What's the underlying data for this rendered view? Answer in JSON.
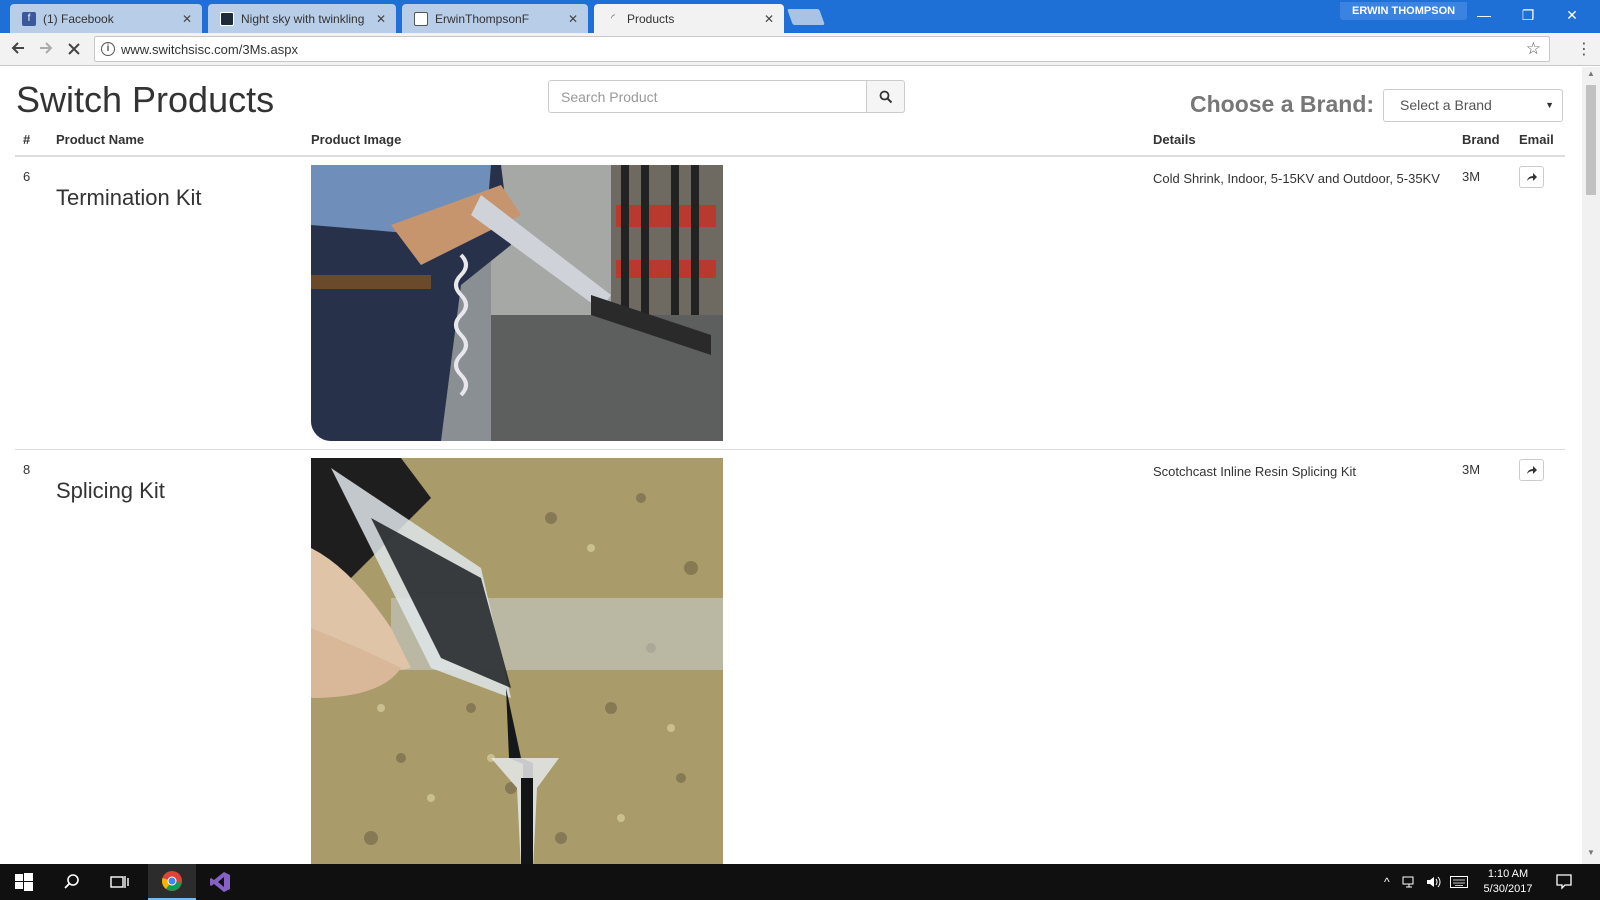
{
  "browser": {
    "tabs": [
      {
        "label": "(1) Facebook",
        "icon": "facebook-icon",
        "active": false
      },
      {
        "label": "Night sky with twinkling",
        "icon": "image-icon",
        "active": false
      },
      {
        "label": "ErwinThompsonF",
        "icon": "document-icon",
        "active": false
      },
      {
        "label": "Products",
        "icon": "loading-icon",
        "active": true
      }
    ],
    "tab_close": "✕",
    "profile_name": "ERWIN THOMPSON",
    "url": "www.switchsisc.com/3Ms.aspx",
    "window_controls": {
      "minimize": "—",
      "restore": "❐",
      "close": "✕"
    }
  },
  "page": {
    "title": "Switch Products",
    "search": {
      "placeholder": "Search Product",
      "value": ""
    },
    "brand_filter": {
      "label": "Choose a Brand:",
      "selected": "Select a Brand"
    },
    "table": {
      "headers": {
        "num": "#",
        "name": "Product Name",
        "image": "Product Image",
        "details": "Details",
        "brand": "Brand",
        "email": "Email"
      },
      "rows": [
        {
          "num": "6",
          "name": "Termination Kit",
          "details": "Cold Shrink, Indoor, 5-15KV and Outdoor, 5-35KV",
          "brand": "3M",
          "image": "termination-kit-photo"
        },
        {
          "num": "8",
          "name": "Splicing Kit",
          "details": "Scotchcast Inline Resin Splicing Kit",
          "brand": "3M",
          "image": "splicing-kit-photo"
        }
      ]
    }
  },
  "taskbar": {
    "time": "1:10 AM",
    "date": "5/30/2017"
  },
  "colors": {
    "titlebar": "#1e6fd6",
    "taskbar": "#101010"
  }
}
